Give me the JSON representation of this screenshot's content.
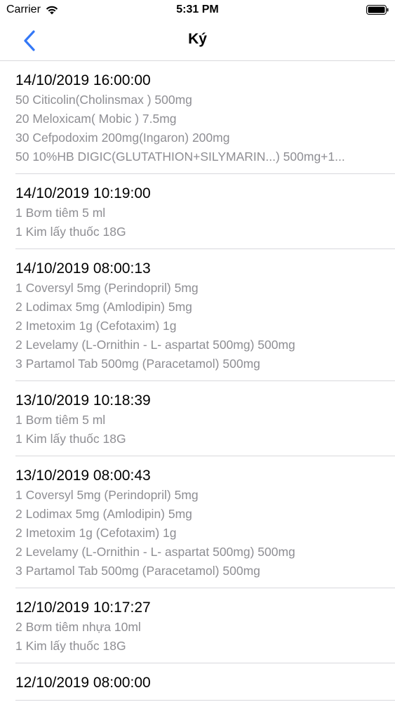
{
  "status_bar": {
    "carrier": "Carrier",
    "time": "5:31 PM"
  },
  "nav": {
    "title": "Ký",
    "back_icon": "chevron-left-icon",
    "accent_color": "#3478f6"
  },
  "entries": [
    {
      "time": "14/10/2019 16:00:00",
      "lines": [
        "50 Citicolin(Cholinsmax ) 500mg",
        "20 Meloxicam( Mobic ) 7.5mg",
        "30 Cefpodoxim 200mg(Ingaron) 200mg",
        "50 10%HB DIGIC(GLUTATHION+SILYMARIN...) 500mg+1..."
      ]
    },
    {
      "time": "14/10/2019 10:19:00",
      "lines": [
        "1 Bơm tiêm 5 ml",
        "1 Kim lấy thuốc 18G"
      ]
    },
    {
      "time": "14/10/2019 08:00:13",
      "lines": [
        "1 Coversyl 5mg (Perindopril) 5mg",
        "2 Lodimax 5mg (Amlodipin) 5mg",
        "2 Imetoxim 1g (Cefotaxim) 1g",
        "2 Levelamy (L-Ornithin - L- aspartat 500mg) 500mg",
        "3 Partamol Tab 500mg (Paracetamol) 500mg"
      ]
    },
    {
      "time": "13/10/2019 10:18:39",
      "lines": [
        "1 Bơm tiêm 5 ml",
        "1 Kim lấy thuốc 18G"
      ]
    },
    {
      "time": "13/10/2019 08:00:43",
      "lines": [
        "1 Coversyl 5mg (Perindopril) 5mg",
        "2 Lodimax 5mg (Amlodipin) 5mg",
        "2 Imetoxim 1g (Cefotaxim) 1g",
        "2 Levelamy (L-Ornithin - L- aspartat 500mg) 500mg",
        "3 Partamol Tab 500mg (Paracetamol) 500mg"
      ]
    },
    {
      "time": "12/10/2019 10:17:27",
      "lines": [
        "2 Bơm tiêm nhựa 10ml",
        "1 Kim lấy thuốc 18G"
      ]
    },
    {
      "time": "12/10/2019 08:00:00",
      "lines": []
    }
  ]
}
